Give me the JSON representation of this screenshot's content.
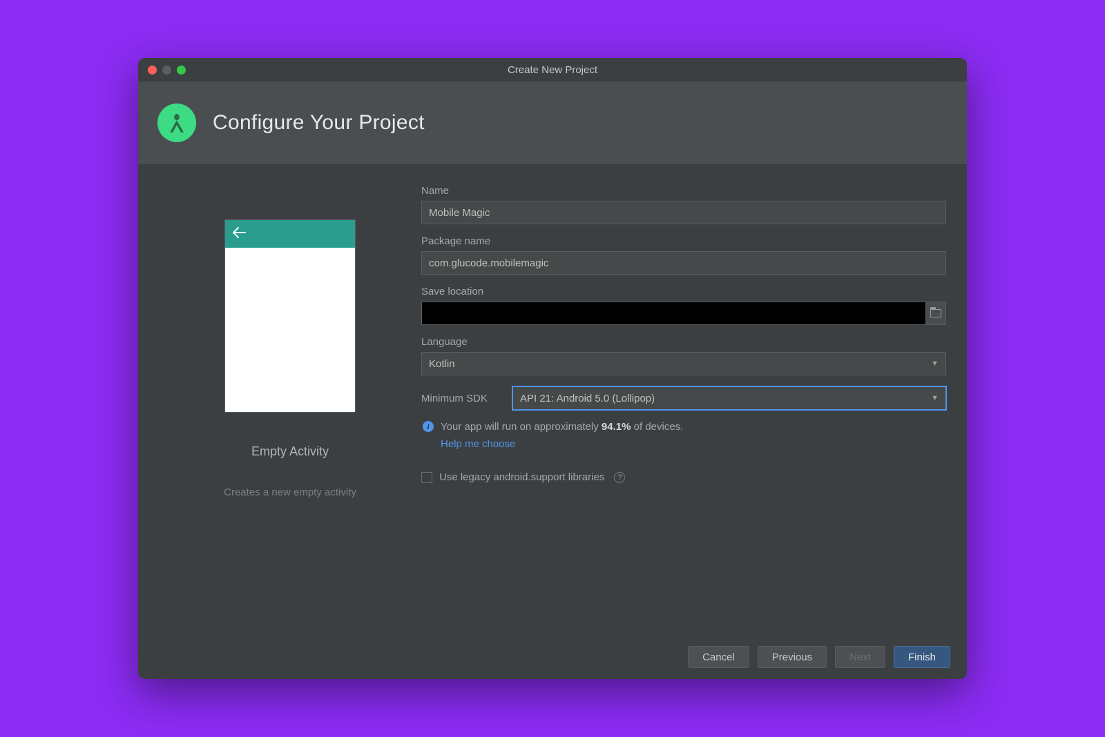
{
  "window": {
    "title": "Create New Project"
  },
  "header": {
    "title": "Configure Your Project"
  },
  "preview": {
    "title": "Empty Activity",
    "subtitle": "Creates a new empty activity"
  },
  "form": {
    "name_label": "Name",
    "name_value": "Mobile Magic",
    "package_label": "Package name",
    "package_value": "com.glucode.mobilemagic",
    "save_label": "Save location",
    "save_value": "",
    "language_label": "Language",
    "language_value": "Kotlin",
    "sdk_label": "Minimum SDK",
    "sdk_value": "API 21: Android 5.0 (Lollipop)",
    "info_prefix": "Your app will run on approximately ",
    "info_pct": "94.1%",
    "info_suffix": " of devices.",
    "help_link": "Help me choose",
    "legacy_label": "Use legacy android.support libraries"
  },
  "footer": {
    "cancel": "Cancel",
    "previous": "Previous",
    "next": "Next",
    "finish": "Finish"
  }
}
